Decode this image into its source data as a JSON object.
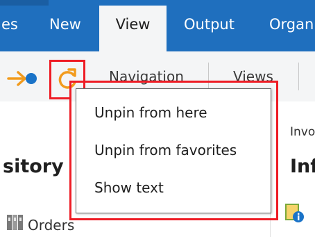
{
  "ribbon": {
    "tabs": [
      {
        "label": "es"
      },
      {
        "label": "New"
      },
      {
        "label": "View",
        "active": true
      },
      {
        "label": "Output"
      },
      {
        "label": "Organ"
      }
    ]
  },
  "toolbar": {
    "navigation_label": "Navigation",
    "views_label": "Views",
    "icons": [
      "arrow-right-dot-icon",
      "refresh-icon"
    ]
  },
  "content": {
    "left_heading": "sitory",
    "right_small": "Invo",
    "right_heading": "Inf",
    "list_item_label": "Orders",
    "list_icon": "folder-icon",
    "right_icon": "document-info-icon"
  },
  "context_menu": {
    "items": [
      {
        "label": "Unpin from here"
      },
      {
        "label": "Unpin from favorites"
      },
      {
        "label": "Show text"
      }
    ]
  },
  "colors": {
    "ribbon_blue": "#1f6fbe",
    "highlight_red": "#ee1c25",
    "icon_orange": "#f29b1d",
    "icon_blue": "#1a73c8"
  }
}
